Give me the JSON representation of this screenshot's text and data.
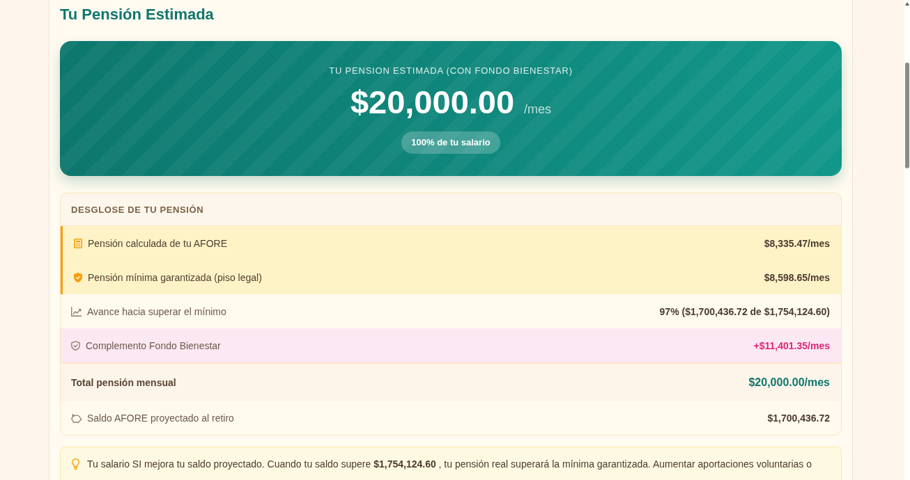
{
  "title": "Tu Pensión Estimada",
  "hero": {
    "label": "TU PENSION ESTIMADA (CON FONDO BIENESTAR)",
    "amount": "$20,000.00",
    "unit": "/mes",
    "badge": "100% de tu salario"
  },
  "breakdown": {
    "heading": "DESGLOSE DE TU PENSIÓN",
    "rows": [
      {
        "kind": "highlight",
        "label": "Pensión calculada de tu AFORE",
        "value": "$8,335.47/mes"
      },
      {
        "kind": "highlight",
        "label": "Pensión mínima garantizada (piso legal)",
        "value": "$8,598.65/mes"
      },
      {
        "kind": "plain",
        "label": "Avance hacia superar el mínimo",
        "value": "97% ($1,700,436.72 de $1,754,124.60)"
      },
      {
        "kind": "bonus",
        "label": "Complemento Fondo Bienestar",
        "value": "+$11,401.35/mes"
      },
      {
        "kind": "total",
        "label": "Total pensión mensual",
        "value": "$20,000.00/mes"
      },
      {
        "kind": "plain",
        "label": "Saldo AFORE proyectado al retiro",
        "value": "$1,700,436.72"
      }
    ]
  },
  "tip": {
    "text": "Tu salario SI mejora tu saldo proyectado. Cuando tu saldo supere **$1,754,124.60** , tu pensión real superará la mínima garantizada. Aumentar aportaciones voluntarias o"
  }
}
